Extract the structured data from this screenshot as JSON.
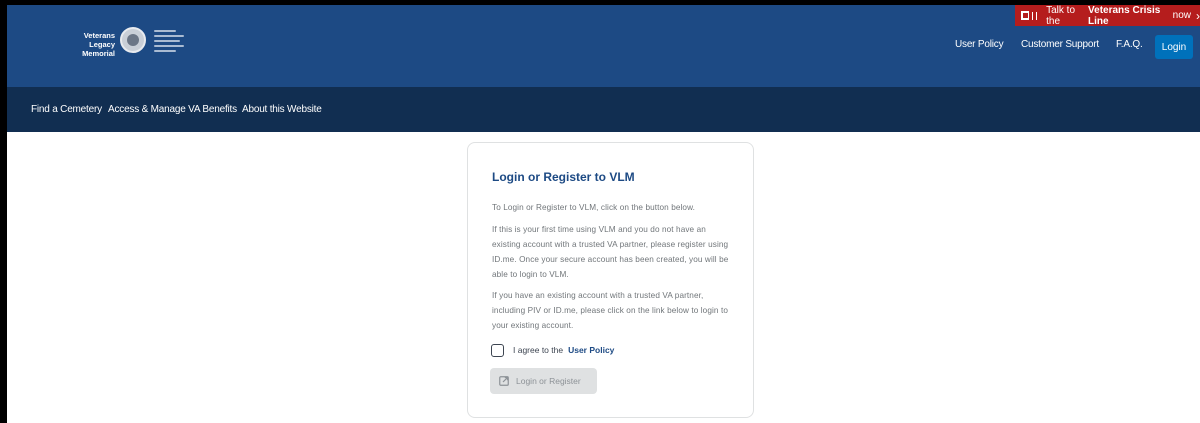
{
  "header": {
    "logo_text": "Veterans Legacy Memorial",
    "crisis_prefix": "Talk to the",
    "crisis_bold": "Veterans Crisis Line",
    "crisis_suffix": "now",
    "links": [
      "User Policy",
      "Customer Support",
      "F.A.Q."
    ],
    "login_label": "Login"
  },
  "nav": {
    "items": [
      "Find a Cemetery",
      "Access & Manage VA Benefits",
      "About this Website"
    ]
  },
  "card": {
    "title": "Login or Register to VLM",
    "p1": "To Login or Register to VLM, click on the button below.",
    "p2": "If this is your first time using VLM and you do not have an existing account with a trusted VA partner, please register using ID.me. Once your secure account has been created, you will be able to login to VLM.",
    "p3": "If you have an existing account with a trusted VA partner, including PIV or ID.me, please click on the link below to login to your existing account.",
    "agree_prefix": "I agree to the",
    "agree_link": "User Policy",
    "button_label": "Login or Register"
  },
  "colors": {
    "header_bg": "#1d4a84",
    "nav_bg": "#112e51",
    "crisis_bg": "#b51d1d",
    "login_bg": "#0071bb",
    "title_color": "#1d4a84",
    "disabled_button_bg": "#dfe1e2"
  },
  "icons": {
    "crisis": "crisis-line-icon",
    "seal": "va-seal-icon",
    "register": "external-link-icon",
    "chevron": "chevron-right-icon"
  }
}
